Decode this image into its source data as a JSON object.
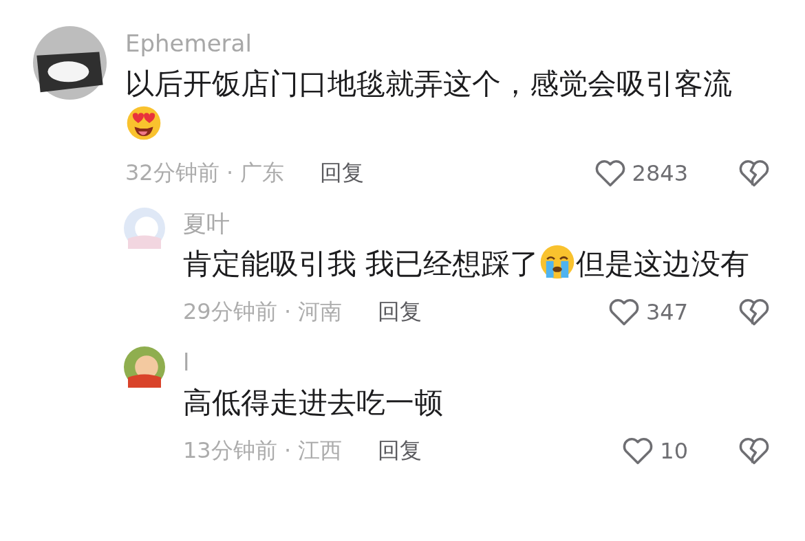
{
  "comments": [
    {
      "name": "Ephemeral",
      "body": [
        {
          "kind": "text",
          "text": "以后开饭店门口地毯就弄这个，感觉会吸引客流"
        },
        {
          "kind": "lovestruck"
        }
      ],
      "time": "32分钟前 · 广东",
      "reply": "回复",
      "likes": "2843",
      "replies": [
        {
          "name": "夏叶",
          "body": [
            {
              "kind": "text",
              "text": "肯定能吸引我 我已经想踩了"
            },
            {
              "kind": "crying"
            },
            {
              "kind": "text",
              "text": "但是这边没有"
            }
          ],
          "time": "29分钟前 · 河南",
          "reply": "回复",
          "likes": "347"
        },
        {
          "name": "l",
          "body": [
            {
              "kind": "text",
              "text": "高低得走进去吃一顿"
            }
          ],
          "time": "13分钟前 · 江西",
          "reply": "回复",
          "likes": "10"
        }
      ]
    }
  ]
}
